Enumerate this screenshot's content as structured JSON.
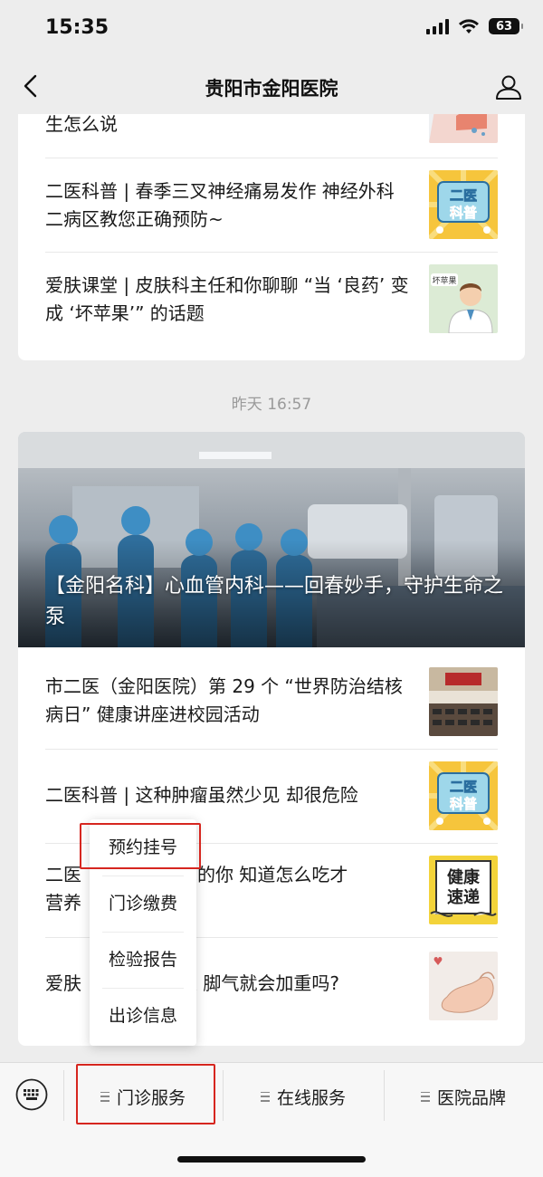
{
  "status_bar": {
    "time": "15:35",
    "battery": "63"
  },
  "nav": {
    "title": "贵阳市金阳医院"
  },
  "card1": {
    "items": [
      {
        "text": "生怎么说",
        "thumb": "map-thumbnail"
      },
      {
        "text": "二医科普 | 春季三叉神经痛易发作 神经外科二病区教您正确预防~",
        "thumb": "science-thumbnail",
        "thumb_text": [
          "二医",
          "科普"
        ]
      },
      {
        "text": "爱肤课堂 | 皮肤科主任和你聊聊 “当 ‘良药’ 变成 ‘坏苹果’” 的话题",
        "thumb": "doctor-thumbnail",
        "thumb_text": "坏苹果"
      }
    ]
  },
  "timestamp": "昨天 16:57",
  "card2": {
    "hero_title": "【金阳名科】心血管内科——回春妙手，守护生命之泵",
    "items": [
      {
        "text": "市二医（金阳医院）第 29 个 “世界防治结核病日” 健康讲座进校园活动",
        "thumb": "lecture-photo-thumbnail"
      },
      {
        "text": "二医科普 | 这种肿瘤虽然少见 却很危险",
        "thumb": "science-thumbnail",
        "thumb_text": [
          "二医",
          "科普"
        ]
      },
      {
        "text_left": "二医",
        "text_right": "手术的你 知道怎么吃才",
        "text_line2": "营养",
        "thumb": "health-express-thumbnail",
        "thumb_text": [
          "健康",
          "速递"
        ]
      },
      {
        "text_left": "爱肤",
        "text_right": "天 脚气就会加重吗?",
        "thumb": "foot-thumbnail"
      }
    ]
  },
  "popup_menu": {
    "items": [
      "预约挂号",
      "门诊缴费",
      "检验报告",
      "出诊信息"
    ]
  },
  "bottom_menu": {
    "items": [
      "门诊服务",
      "在线服务",
      "医院品牌"
    ]
  },
  "colors": {
    "highlight": "#d6261f",
    "background": "#ededed"
  }
}
